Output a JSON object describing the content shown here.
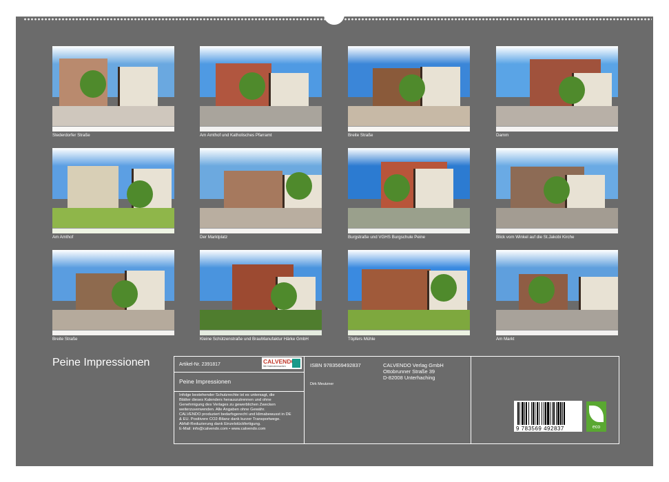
{
  "calendar": {
    "title": "Peine Impressionen"
  },
  "photos": [
    {
      "caption": "Stederdorfer Straße",
      "sky": "#6aa8e0",
      "ground": "#cfc7bd",
      "bldg": "#b98a6e"
    },
    {
      "caption": "Am Amthof und Katholisches Pfarramt",
      "sky": "#4f9ae3",
      "ground": "#a9a49c",
      "bldg": "#b1563f"
    },
    {
      "caption": "Breite Straße",
      "sky": "#3b86d8",
      "ground": "#c7b9a6",
      "bldg": "#8a5a3a"
    },
    {
      "caption": "Damm",
      "sky": "#5aa4e6",
      "ground": "#b8b0a7",
      "bldg": "#a0523c"
    },
    {
      "caption": "Am Amthof",
      "sky": "#5c9fe3",
      "ground": "#8fb64a",
      "bldg": "#d8cfb6"
    },
    {
      "caption": "Der Marktplatz",
      "sky": "#6ca9df",
      "ground": "#b9aea0",
      "bldg": "#a6795e"
    },
    {
      "caption": "Burgstraße und VGHS Burgschule Peine",
      "sky": "#2c7bd1",
      "ground": "#9aa08c",
      "bldg": "#b8553a"
    },
    {
      "caption": "Blick vom Winkel auf die St.Jakobi Kirche",
      "sky": "#6aaae4",
      "ground": "#a39c92",
      "bldg": "#8d6b55"
    },
    {
      "caption": "Breite Straße",
      "sky": "#5a9de0",
      "ground": "#b5aa9c",
      "bldg": "#8e6a4e"
    },
    {
      "caption": "Kleine Schützenstraße und BrauManufaktur Härke GmbH",
      "sky": "#4a94de",
      "ground": "#4f7d2e",
      "bldg": "#9c4a31"
    },
    {
      "caption": "Töpfers Mühle",
      "sky": "#3a8ae0",
      "ground": "#7ea83e",
      "bldg": "#a05a3a"
    },
    {
      "caption": "Am Markt",
      "sky": "#5f9fdd",
      "ground": "#a8a29a",
      "bldg": "#8f5d44"
    }
  ],
  "info": {
    "article_label": "Artikel-Nr. 2391817",
    "isbn": "ISBN 9783569492837",
    "publisher_name": "CALVENDO Verlag GmbH",
    "publisher_street": "Ottobrunner Straße 39",
    "publisher_city": "D-82008 Unterhaching",
    "product_title": "Peine Impressionen",
    "author": "Dirk Meutzner",
    "legal_text": "Infolge bestehender Schutzrechte ist es untersagt, die\nBlätter dieses Kalenders herauszutrennen und ohne\nGenehmigung des Verlages zu gewerblichen Zwecken\nweiterzuverwenden. Alle Angaben ohne Gewähr.\nCALVENDO produziert bedarfsgerecht und klimabewusst in DE\n& EU. Positivere CO2-Bilanz dank kurzer Transportwege.\nAbfall-Reduzierung dank Einzelstückfertigung.\nE-Mail: info@calvendo.com • www.calvendo.com",
    "logo_text": "CALVENDO",
    "logo_sub": "Wir Kalendermachen",
    "barcode_digits": "9 783569 492837",
    "eco_label": "eco"
  }
}
